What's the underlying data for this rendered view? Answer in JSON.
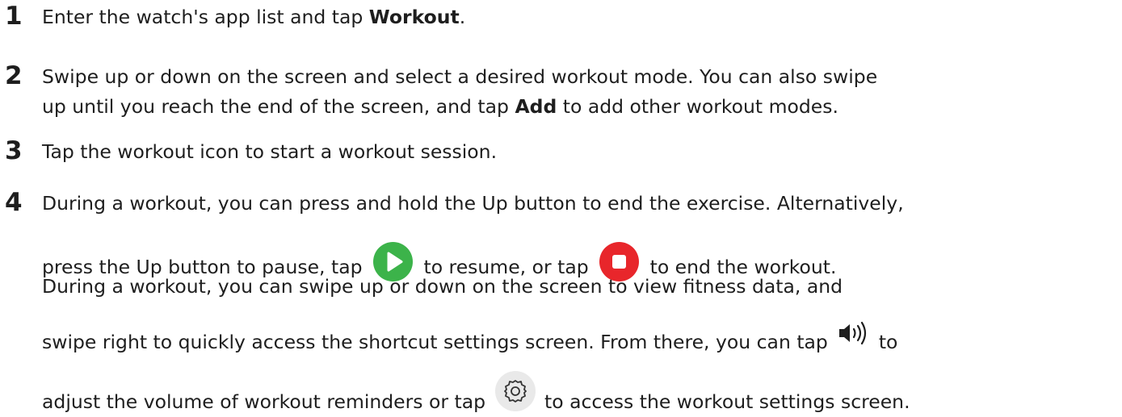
{
  "steps": [
    {
      "number": "1",
      "lines": [
        {
          "pre": "Enter the watch's app list and tap ",
          "bold": "Workout",
          "post": "."
        }
      ]
    },
    {
      "number": "2",
      "lines": [
        {
          "text": "Swipe up or down on the screen and select a desired workout mode. You can also swipe"
        },
        {
          "pre": "up until you reach the end of the screen, and tap ",
          "bold": "Add",
          "post": " to add other workout modes."
        }
      ]
    },
    {
      "number": "3",
      "lines": [
        {
          "text": "Tap the workout icon to start a workout session."
        }
      ]
    },
    {
      "number": "4",
      "lines": [
        {
          "text": "During a workout, you can press and hold the Up button to end the exercise. Alternatively,"
        },
        {
          "a": "press the Up button to pause, tap",
          "b": "to resume, or tap",
          "c": "to end the workout."
        },
        {
          "text": "During a workout, you can swipe up or down on the screen to view fitness data, and"
        },
        {
          "a": "swipe right to quickly access the shortcut settings screen. From there, you can tap",
          "b": "to"
        },
        {
          "a": "adjust the volume of workout reminders or tap",
          "b": "to access the workout settings screen."
        }
      ]
    }
  ],
  "icons": {
    "play": {
      "name": "play-icon",
      "color": "#3cb34a"
    },
    "stop": {
      "name": "stop-icon",
      "color": "#e8262b"
    },
    "volume": {
      "name": "volume-icon",
      "color": "#1e1e1e"
    },
    "settings": {
      "name": "gear-icon",
      "color": "#333333"
    }
  }
}
